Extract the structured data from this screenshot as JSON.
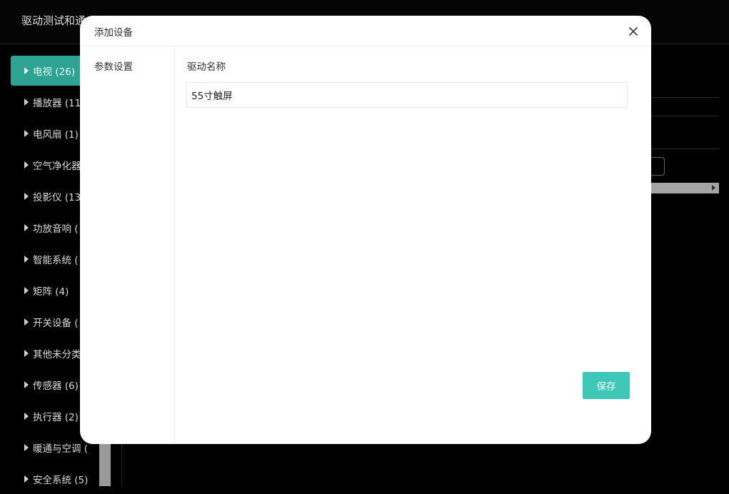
{
  "app": {
    "title": "驱动测试和通"
  },
  "sidebar": {
    "items": [
      {
        "label": "电视 (26)",
        "active": true
      },
      {
        "label": "播放器 (11)"
      },
      {
        "label": "电风扇 (1)"
      },
      {
        "label": "空气净化器"
      },
      {
        "label": "投影仪 (13)"
      },
      {
        "label": "功放音响 ("
      },
      {
        "label": "智能系统 ("
      },
      {
        "label": "矩阵 (4)"
      },
      {
        "label": "开关设备 ("
      },
      {
        "label": "其他未分类"
      },
      {
        "label": "传感器 (6)"
      },
      {
        "label": "执行器 (2)"
      },
      {
        "label": "暖通与空调 ("
      },
      {
        "label": "安全系统 (5)"
      }
    ]
  },
  "modal": {
    "title": "添加设备",
    "nav": {
      "params_label": "参数设置"
    },
    "form": {
      "driver_name_label": "驱动名称",
      "driver_name_value": "55寸触屏"
    },
    "save_label": "保存"
  },
  "colors": {
    "accent": "#3ec7b7",
    "active_item": "#2ea393",
    "background": "#000000"
  }
}
